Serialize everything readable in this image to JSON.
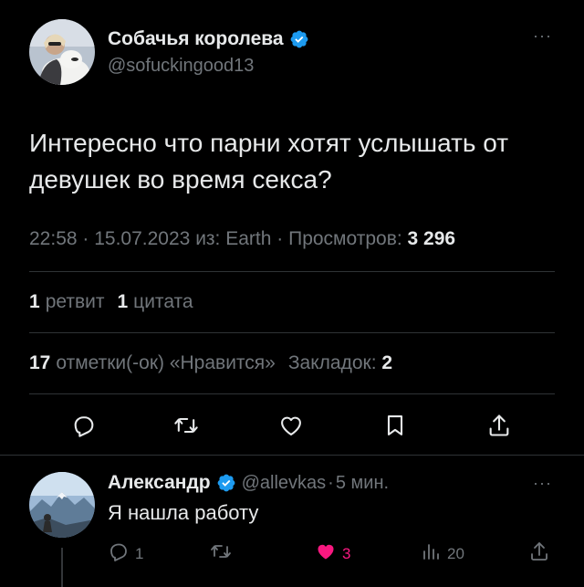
{
  "tweet": {
    "author_name": "Собачья королева",
    "author_handle": "@sofuckingood13",
    "text": "Интересно что парни хотят услышать от девушек во время секса?",
    "time": "22:58",
    "date": "15.07.2023",
    "source_prefix": "из:",
    "source": "Earth",
    "views_label": "Просмотров:",
    "views": "3 296",
    "retweets_count": "1",
    "retweets_label": "ретвит",
    "quotes_count": "1",
    "quotes_label": "цитата",
    "likes_count": "17",
    "likes_label": "отметки(-ок) «Нравится»",
    "bookmarks_label": "Закладок:",
    "bookmarks_count": "2"
  },
  "reply": {
    "author_name": "Александр",
    "author_handle": "@allevkas",
    "time_ago": "5 мин.",
    "text": "Я нашла работу",
    "reply_count": "1",
    "like_count": "3",
    "view_count": "20"
  },
  "icons": {
    "verified": "verified-badge-icon",
    "more": "more-icon",
    "reply": "reply-icon",
    "retweet": "retweet-icon",
    "like": "heart-icon",
    "bookmark": "bookmark-icon",
    "share": "share-icon",
    "views": "views-icon"
  },
  "colors": {
    "background": "#000000",
    "text": "#e7e9ea",
    "secondary": "#71767b",
    "verified": "#1d9bf0",
    "like": "#f91880",
    "divider": "#2f3336"
  }
}
